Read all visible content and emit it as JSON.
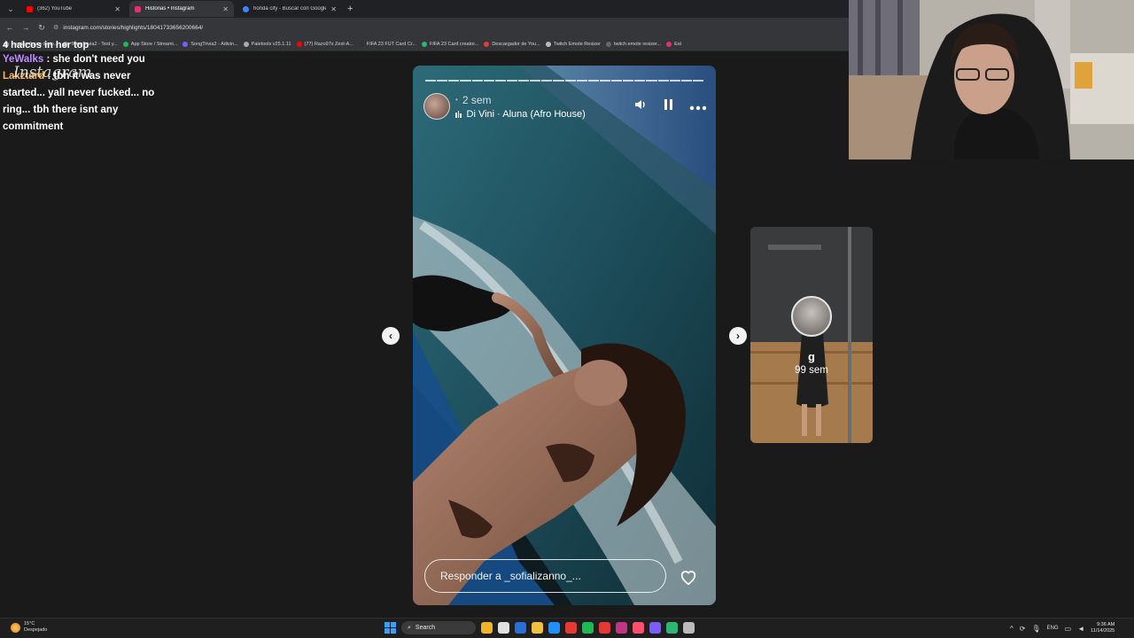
{
  "browser": {
    "tabs": [
      {
        "label": "(362) YouTube",
        "color": "#ff0000",
        "active": false
      },
      {
        "label": "Historias • Instagram",
        "color": "#e1306c",
        "active": true
      },
      {
        "label": "honda city - Buscar con Google",
        "color": "#4285f4",
        "active": false
      }
    ],
    "url": "instagram.com/stories/highlights/18041733656200664/",
    "bookmarks": [
      {
        "label": "...urago figura de to...",
        "color": "#999"
      },
      {
        "label": "SongTrivia2 - Test y...",
        "color": "#888"
      },
      {
        "label": "App Store / Streami...",
        "color": "#1db954"
      },
      {
        "label": "SongTrivia2 - Adivin...",
        "color": "#7b5cff"
      },
      {
        "label": "Paletools v25.1.11",
        "color": "#aaa"
      },
      {
        "label": "(77) Razo97s Zest-A...",
        "color": "#ff0000"
      },
      {
        "label": "FIFA 23 FUT Card Cr...",
        "color": "#333"
      },
      {
        "label": "FIFA 23 Card creator...",
        "color": "#2bb673"
      },
      {
        "label": "Descargador de You...",
        "color": "#e53935"
      },
      {
        "label": "Twitch Emote Resizer",
        "color": "#bbb"
      },
      {
        "label": "twitch emote resizer...",
        "color": "#666"
      },
      {
        "label": "Est",
        "color": "#e1306c"
      }
    ]
  },
  "chat": {
    "cut_line": "4 halcos in her top",
    "logo_text": "Instagram",
    "messages": [
      {
        "user": "YeWalks",
        "text": " : she don't need you"
      },
      {
        "user": "Lakztard",
        "text": " : tbh it was never started... yall never fucked... no ring... tbh there isnt any commitment"
      }
    ]
  },
  "story": {
    "segments": 24,
    "time": "2 sem",
    "song": "Di Vini · Aluna (Afro House)",
    "reply_placeholder": "Responder a _sofializanno_...",
    "icons": {
      "sound": "speaker-icon",
      "pause": "pause-icon",
      "more": "more-icon",
      "like": "heart-icon"
    }
  },
  "next_story": {
    "user": "g",
    "time": "99 sem"
  },
  "taskbar": {
    "weather_temp": "15°C",
    "weather_desc": "Despejado",
    "search_label": "Search",
    "apps": [
      "#f0b429",
      "#e0e0e0",
      "#2a6fd6",
      "#f0c040",
      "#1e90ff",
      "#e53935",
      "#1db954",
      "#e53935",
      "#c13584",
      "#ff4f6d",
      "#7b5cff",
      "#2bb673",
      "#bbbbbb"
    ],
    "lang": "ENG",
    "time": "9:36 AM",
    "date": "11/14/2025"
  }
}
